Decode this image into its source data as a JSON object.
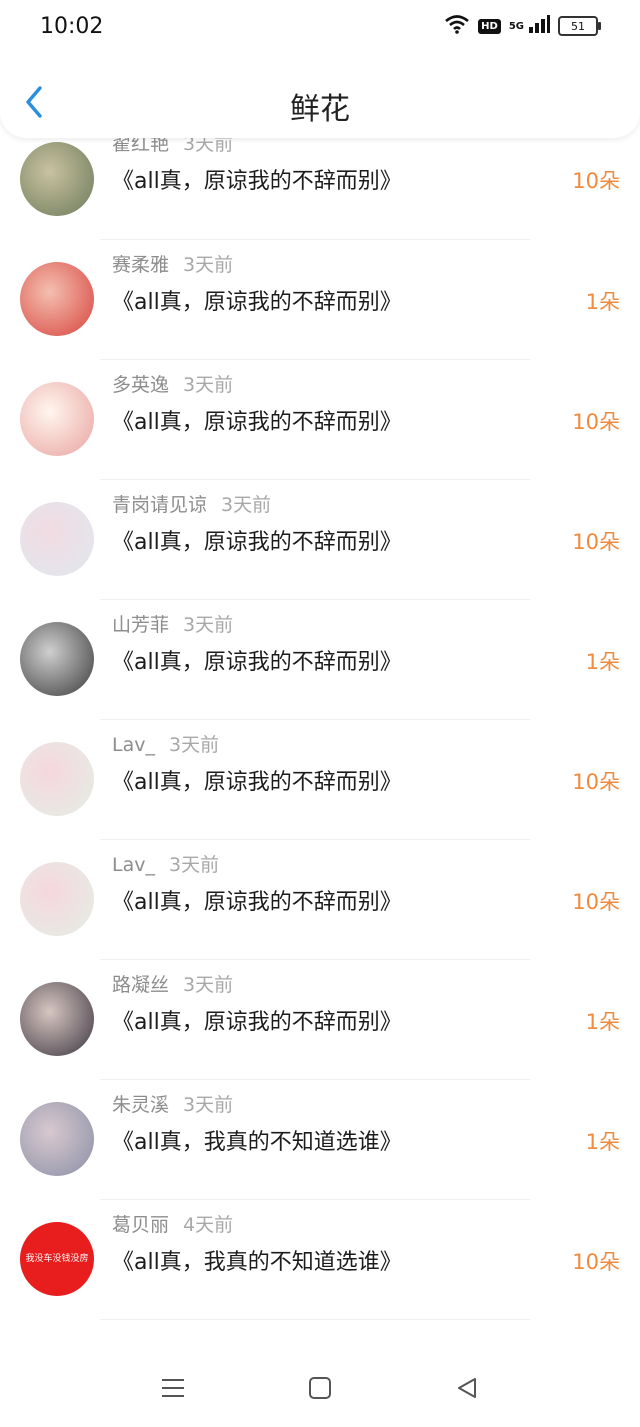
{
  "status": {
    "time": "10:02",
    "hd": "HD",
    "network": "5G",
    "battery": "51"
  },
  "header": {
    "title": "鲜花"
  },
  "items": [
    {
      "name": "翟红艳",
      "time": "3天前",
      "book": "《all真，原谅我的不辞而别》",
      "flowers": "10朵",
      "avatar_colors": [
        "#6b7a5a",
        "#c9c2a0"
      ]
    },
    {
      "name": "赛柔雅",
      "time": "3天前",
      "book": "《all真，原谅我的不辞而别》",
      "flowers": "1朵",
      "avatar_colors": [
        "#d7433e",
        "#f4c0b0"
      ]
    },
    {
      "name": "多英逸",
      "time": "3天前",
      "book": "《all真，原谅我的不辞而别》",
      "flowers": "10朵",
      "avatar_colors": [
        "#e9a2a0",
        "#fff6ee"
      ]
    },
    {
      "name": "青岗请见谅",
      "time": "3天前",
      "book": "《all真，原谅我的不辞而别》",
      "flowers": "10朵",
      "avatar_colors": [
        "#dfe8ee",
        "#f2dbe2"
      ]
    },
    {
      "name": "山芳菲",
      "time": "3天前",
      "book": "《all真，原谅我的不辞而别》",
      "flowers": "1朵",
      "avatar_colors": [
        "#3a3a3a",
        "#cfcfcf"
      ]
    },
    {
      "name": "Lav_",
      "time": "3天前",
      "book": "《all真，原谅我的不辞而别》",
      "flowers": "10朵",
      "avatar_colors": [
        "#e4eee4",
        "#f6d7df"
      ]
    },
    {
      "name": "Lav_",
      "time": "3天前",
      "book": "《all真，原谅我的不辞而别》",
      "flowers": "10朵",
      "avatar_colors": [
        "#e4eee4",
        "#f6d7df"
      ]
    },
    {
      "name": "路凝丝",
      "time": "3天前",
      "book": "《all真，原谅我的不辞而别》",
      "flowers": "1朵",
      "avatar_colors": [
        "#3b3540",
        "#d7c6c1"
      ]
    },
    {
      "name": "朱灵溪",
      "time": "3天前",
      "book": "《all真，我真的不知道选谁》",
      "flowers": "1朵",
      "avatar_colors": [
        "#8a8fa6",
        "#d8c9cf"
      ]
    },
    {
      "name": "葛贝丽",
      "time": "4天前",
      "book": "《all真，我真的不知道选谁》",
      "flowers": "10朵",
      "avatar_colors": [
        "#e81d1d",
        "#e81d1d"
      ],
      "avatar_text": "我没车没钱没房"
    }
  ],
  "colors": {
    "accent": "#2a8ee0",
    "flowers": "#f08a3c",
    "meta": "#8d8d8d"
  },
  "nav": {
    "icons": [
      "menu-icon",
      "home-square-icon",
      "back-triangle-icon"
    ]
  }
}
